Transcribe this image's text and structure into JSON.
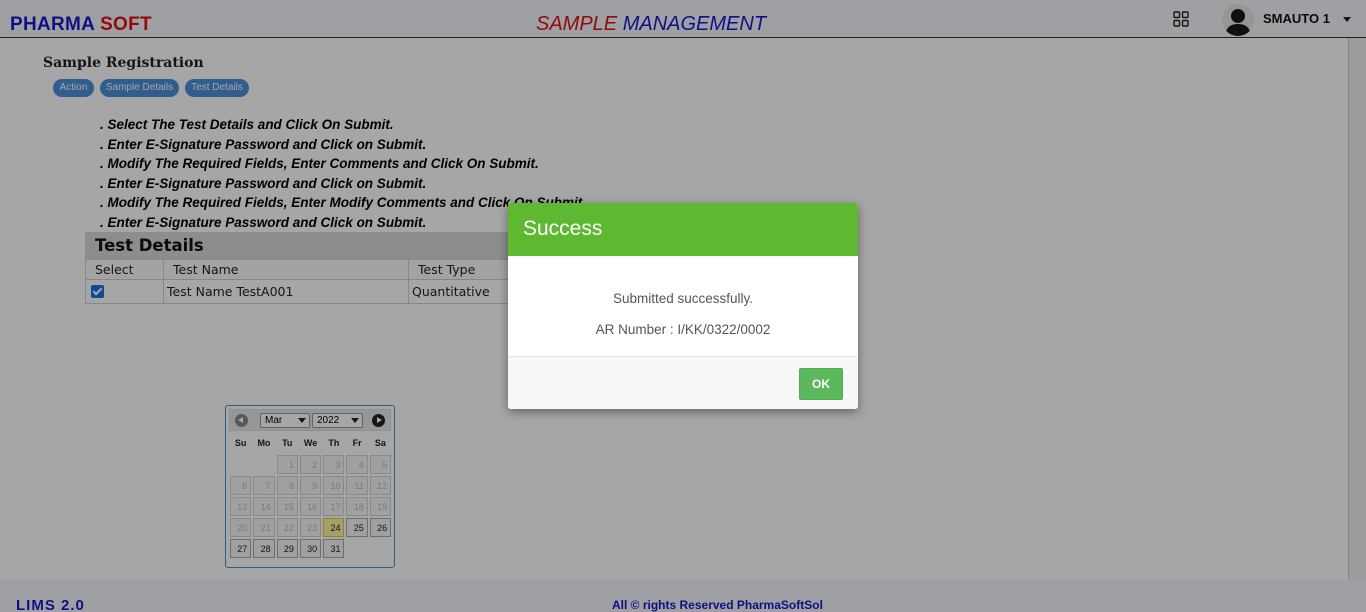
{
  "header": {
    "brand_part1": "PHARMA",
    "brand_part2": "SOFT",
    "module_part1": "SAMPLE",
    "module_part2": "MANAGEMENT",
    "user_name": "SMAUTO 1",
    "icons": [
      "grid-icon",
      "avatar",
      "caret-down-icon"
    ]
  },
  "page": {
    "heading": "Sample Registration",
    "pills": [
      "Action",
      "Sample Details",
      "Test Details"
    ],
    "instructions": [
      ". Select The Test Details and Click On Submit.",
      ". Enter E-Signature Password and Click on Submit.",
      ". Modify The Required Fields, Enter Comments and Click On Submit.",
      ". Enter E-Signature Password and Click on Submit.",
      ". Modify The Required Fields, Enter Modify Comments and Click On Submit.",
      ". Enter E-Signature Password and Click on Submit."
    ]
  },
  "test_details": {
    "title": "Test Details",
    "columns": [
      "Select",
      "Test Name",
      "Test Type"
    ],
    "rows": [
      {
        "selected": true,
        "test_name": "Test Name TestA001",
        "test_type": "Quantitative"
      }
    ]
  },
  "datepicker": {
    "month": "Mar",
    "year": "2022",
    "weekdays": [
      "Su",
      "Mo",
      "Tu",
      "We",
      "Th",
      "Fr",
      "Sa"
    ],
    "leading_blanks": 2,
    "days_in_month": 31,
    "today": 24,
    "first_enabled_day": 24
  },
  "footer": {
    "left": "LIMS 2.0",
    "center": "All © rights Reserved PharmaSoftSol"
  },
  "modal": {
    "title": "Success",
    "message": "Submitted successfully.",
    "ar_number": "AR Number : I/KK/0322/0002",
    "ok_label": "OK"
  },
  "colors": {
    "brand_blue": "#1a1acc",
    "brand_red": "#e01010",
    "success_green": "#5fb832",
    "ok_button": "#5cb85c",
    "pill_blue": "#4a90d9"
  }
}
